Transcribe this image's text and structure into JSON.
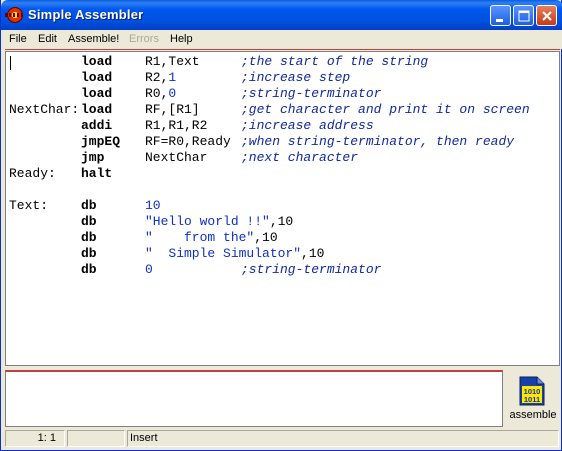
{
  "window": {
    "title": "Simple Assembler"
  },
  "menu": {
    "items": [
      {
        "label": "File",
        "enabled": true
      },
      {
        "label": "Edit",
        "enabled": true
      },
      {
        "label": "Assemble!",
        "enabled": true
      },
      {
        "label": "Errors",
        "enabled": false
      },
      {
        "label": "Help",
        "enabled": true
      }
    ]
  },
  "code": {
    "lines": [
      {
        "label": "",
        "op": "load",
        "args": [
          [
            "R1,Text",
            "plain"
          ]
        ],
        "comment": ";the start of the string"
      },
      {
        "label": "",
        "op": "load",
        "args": [
          [
            "R2,",
            "plain"
          ],
          [
            "1",
            "num"
          ]
        ],
        "comment": ";increase step"
      },
      {
        "label": "",
        "op": "load",
        "args": [
          [
            "R0,",
            "plain"
          ],
          [
            "0",
            "num"
          ]
        ],
        "comment": ";string-terminator"
      },
      {
        "label": "NextChar:",
        "op": "load",
        "args": [
          [
            "RF,[R1]",
            "plain"
          ]
        ],
        "comment": ";get character and print it on screen"
      },
      {
        "label": "",
        "op": "addi",
        "args": [
          [
            "R1,R1,R2",
            "plain"
          ]
        ],
        "comment": ";increase address"
      },
      {
        "label": "",
        "op": "jmpEQ",
        "args": [
          [
            "RF=R0,Ready",
            "plain"
          ]
        ],
        "comment": ";when string-terminator, then ready"
      },
      {
        "label": "",
        "op": "jmp",
        "args": [
          [
            "NextChar",
            "plain"
          ]
        ],
        "comment": ";next character"
      },
      {
        "label": "Ready:",
        "op": "halt",
        "args": [],
        "comment": ""
      },
      {
        "label": "",
        "op": "",
        "args": [],
        "comment": ""
      },
      {
        "label": "Text:",
        "op": "db",
        "args": [
          [
            "10",
            "num"
          ]
        ],
        "comment": ""
      },
      {
        "label": "",
        "op": "db",
        "args": [
          [
            "\"Hello world !!\"",
            "str"
          ],
          [
            ",10",
            "plain"
          ]
        ],
        "comment": ""
      },
      {
        "label": "",
        "op": "db",
        "args": [
          [
            "\"    from the\"",
            "str"
          ],
          [
            ",10",
            "plain"
          ]
        ],
        "comment": ""
      },
      {
        "label": "",
        "op": "db",
        "args": [
          [
            "\"  Simple Simulator\"",
            "str"
          ],
          [
            ",10",
            "plain"
          ]
        ],
        "comment": ""
      },
      {
        "label": "",
        "op": "db",
        "args": [
          [
            "0",
            "num"
          ]
        ],
        "comment": ";string-terminator"
      }
    ]
  },
  "assemble": {
    "label": "assemble",
    "icon_text_top": "1010",
    "icon_text_bottom": "1011"
  },
  "status": {
    "position": "1: 1",
    "middle": "",
    "mode": "Insert"
  }
}
